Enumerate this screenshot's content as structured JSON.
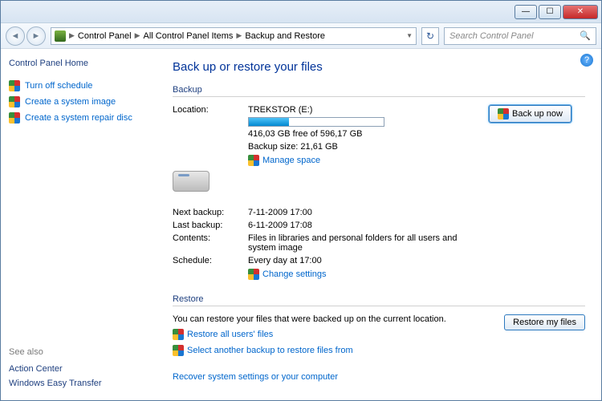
{
  "breadcrumb": {
    "items": [
      "Control Panel",
      "All Control Panel Items",
      "Backup and Restore"
    ]
  },
  "search": {
    "placeholder": "Search Control Panel"
  },
  "sidebar": {
    "home": "Control Panel Home",
    "links": {
      "turnoff": "Turn off schedule",
      "sysimage": "Create a system image",
      "repair": "Create a system repair disc"
    },
    "seealso_hdr": "See also",
    "seealso": {
      "action": "Action Center",
      "easy": "Windows Easy Transfer"
    }
  },
  "main": {
    "title": "Back up or restore your files",
    "backup_hdr": "Backup",
    "restore_hdr": "Restore",
    "labels": {
      "location": "Location:",
      "next": "Next backup:",
      "last": "Last backup:",
      "contents": "Contents:",
      "schedule": "Schedule:"
    },
    "values": {
      "drive": "TREKSTOR (E:)",
      "free": "416,03 GB free of 596,17 GB",
      "size": "Backup size: 21,61 GB",
      "next": "7-11-2009 17:00",
      "last": "6-11-2009 17:08",
      "contents": "Files in libraries and personal folders for all users and system image",
      "schedule": "Every day at 17:00"
    },
    "links": {
      "manage": "Manage space",
      "change": "Change settings",
      "restore_all": "Restore all users' files",
      "select_another": "Select another backup to restore files from",
      "recover": "Recover system settings or your computer"
    },
    "restore_text": "You can restore your files that were backed up on the current location.",
    "buttons": {
      "backup_now": "Back up now",
      "restore": "Restore my files"
    }
  }
}
